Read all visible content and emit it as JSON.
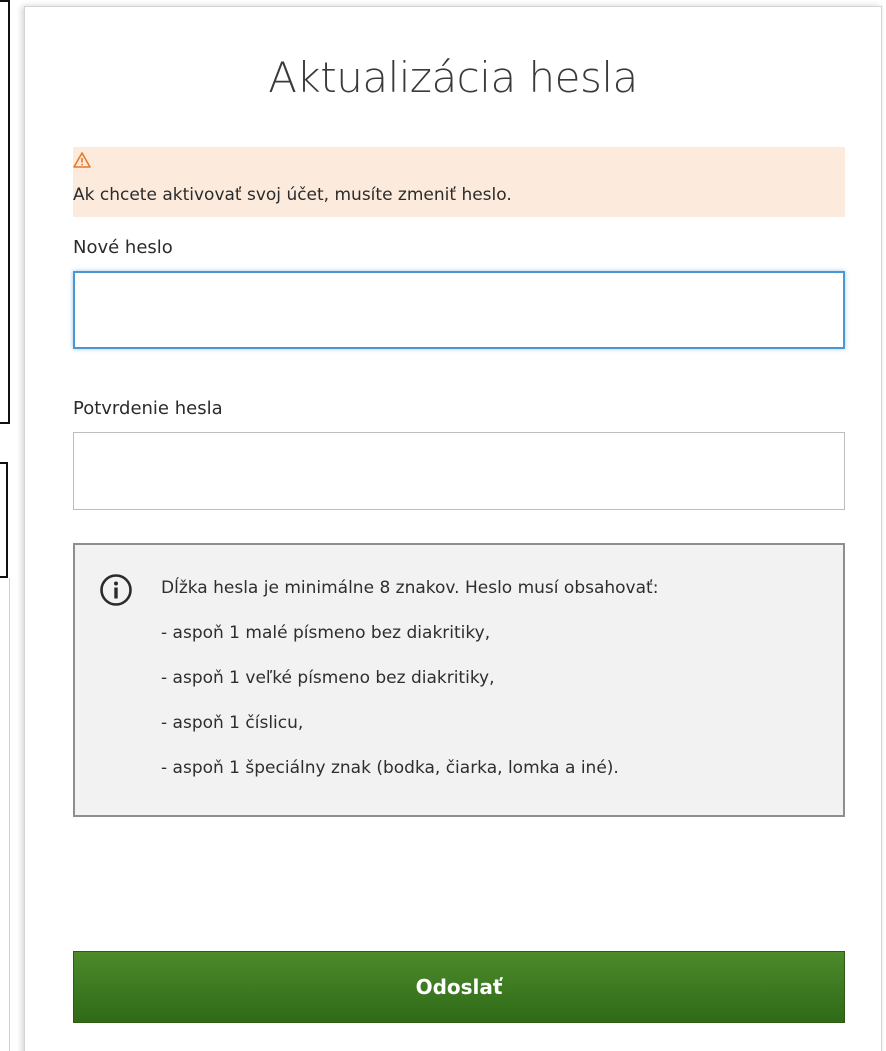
{
  "dialog": {
    "title": "Aktualizácia hesla",
    "alert": {
      "icon": "warning-triangle-icon",
      "message": "Ak chcete aktivovať svoj účet, musíte zmeniť heslo."
    },
    "new_password": {
      "label": "Nové heslo",
      "value": ""
    },
    "confirm_password": {
      "label": "Potvrdenie hesla",
      "value": ""
    },
    "info": {
      "icon": "info-circle-icon",
      "lines": [
        "Dĺžka hesla je minimálne 8 znakov. Heslo musí obsahovať:",
        "- aspoň 1 malé písmeno bez diakritiky,",
        "- aspoň 1 veľké písmeno bez diakritiky,",
        "- aspoň 1 číslicu,",
        "- aspoň 1 špeciálny znak (bodka, čiarka, lomka a iné)."
      ]
    },
    "submit_label": "Odoslať"
  },
  "colors": {
    "alert_background": "#fcebdc",
    "warning_icon": "#e8782a",
    "focus_border": "#4a97d4",
    "info_background": "#f2f2f2",
    "submit_background": "#3c7a22"
  }
}
